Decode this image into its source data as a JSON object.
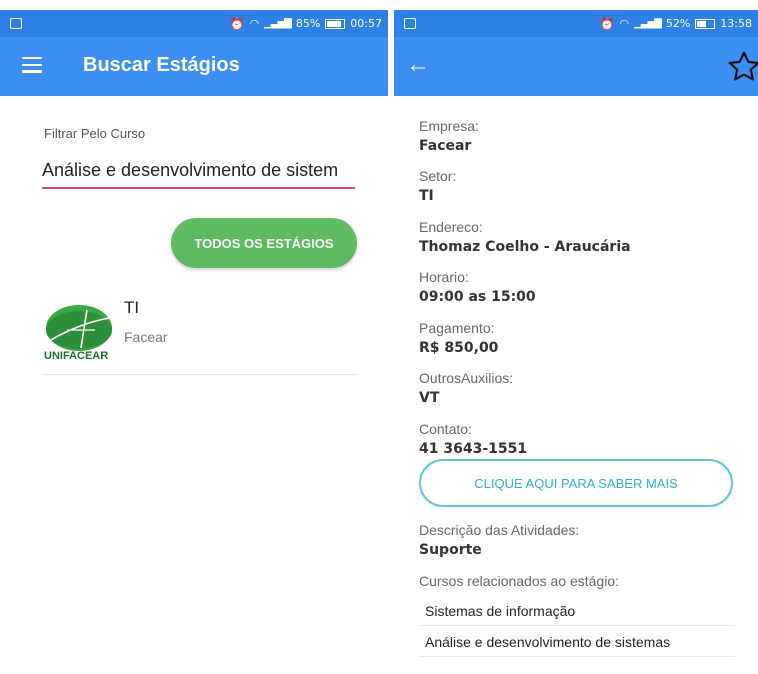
{
  "left": {
    "status": {
      "battery": "85%",
      "time": "00:57"
    },
    "appbar": {
      "title": "Buscar Estágios"
    },
    "filter": {
      "label": "Filtrar Pelo Curso",
      "value": "Análise e desenvolvimento de sistem"
    },
    "all_button": {
      "label": "TODOS OS ESTÁGIOS"
    },
    "results": [
      {
        "title": "TI",
        "company": "Facear",
        "logo_text": "UNIFACEAR"
      }
    ]
  },
  "right": {
    "status": {
      "battery": "52%",
      "time": "13:58"
    },
    "fields": [
      {
        "label": "Empresa:",
        "value": "Facear"
      },
      {
        "label": "Setor:",
        "value": "TI"
      },
      {
        "label": "Endereco:",
        "value": "Thomaz Coelho - Araucária"
      },
      {
        "label": "Horario:",
        "value": "09:00 as 15:00"
      },
      {
        "label": "Pagamento:",
        "value": "R$ 850,00"
      },
      {
        "label": "OutrosAuxilios:",
        "value": "VT"
      },
      {
        "label": "Contato:",
        "value": "41 3643-1551"
      }
    ],
    "more_button": {
      "label": "CLIQUE AQUI PARA SABER MAIS"
    },
    "description": {
      "label": "Descrição das Atividades:",
      "value": "Suporte"
    },
    "related": {
      "label": "Cursos relacionados ao estágio:",
      "items": [
        "Sistemas de informação",
        "Análise e desenvolvimento de sistemas"
      ]
    }
  },
  "colors": {
    "statusbar": "#2c80e6",
    "appbar": "#3a8ff0",
    "green_button": "#5fbb62",
    "outline_button": "#5fc5d8",
    "input_underline": "#e0417e"
  }
}
